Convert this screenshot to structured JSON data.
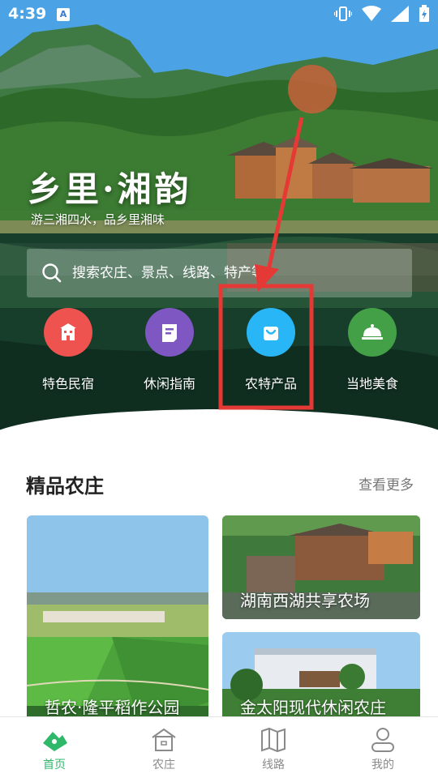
{
  "status_bar": {
    "time": "4:39",
    "notif_badge": "A"
  },
  "hero": {
    "title": "乡里·湘韵",
    "subtitle": "游三湘四水，品乡里湘味"
  },
  "search": {
    "placeholder": "搜索农庄、景点、线路、特产等"
  },
  "quick_nav": [
    {
      "label": "特色民宿",
      "icon": "building-icon",
      "color": "#ef5350"
    },
    {
      "label": "休闲指南",
      "icon": "guide-icon",
      "color": "#7e57c2"
    },
    {
      "label": "农特产品",
      "icon": "shopping-bag-icon",
      "color": "#29b6f6"
    },
    {
      "label": "当地美食",
      "icon": "dish-cover-icon",
      "color": "#43a047"
    }
  ],
  "section": {
    "title": "精品农庄",
    "more": "查看更多"
  },
  "farms": [
    {
      "name": "哲农·隆平稻作公园"
    },
    {
      "name": "湖南西湖共享农场"
    },
    {
      "name": "金太阳现代休闲农庄"
    }
  ],
  "tabs": [
    {
      "label": "首页",
      "icon": "home-mountain-icon",
      "active": true
    },
    {
      "label": "农庄",
      "icon": "farmhouse-icon",
      "active": false
    },
    {
      "label": "线路",
      "icon": "map-icon",
      "active": false
    },
    {
      "label": "我的",
      "icon": "user-icon",
      "active": false
    }
  ],
  "colors": {
    "accent": "#2fb86a",
    "annotation": "#e53935"
  }
}
